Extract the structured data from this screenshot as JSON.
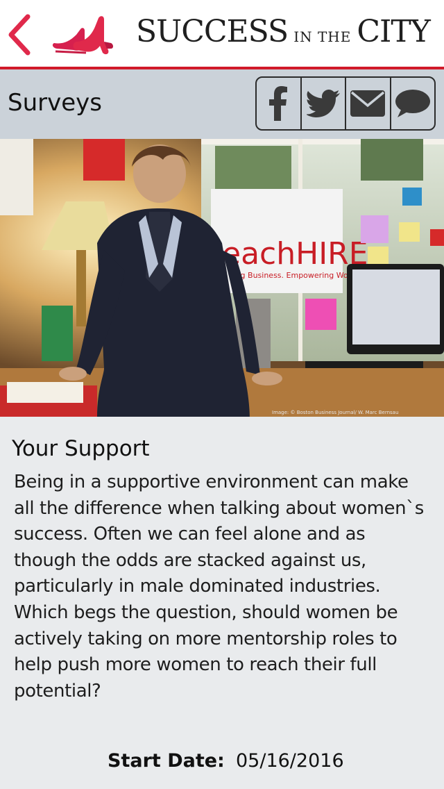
{
  "header": {
    "brand_big_1": "SUCCESS",
    "brand_small": "IN THE",
    "brand_big_2": "CITY",
    "back_icon": "chevron-left-icon",
    "logo_icon": "high-heel-shoes-logo",
    "accent_color": "#d11a2a"
  },
  "toolbar": {
    "title": "Surveys",
    "share_buttons": [
      {
        "icon": "facebook-icon"
      },
      {
        "icon": "twitter-icon"
      },
      {
        "icon": "email-icon"
      },
      {
        "icon": "comment-icon"
      }
    ]
  },
  "hero": {
    "sign_text_1": "eachHIRE",
    "sign_text_2": "ring Business. Empowering Women.",
    "credit": "Image: © Boston Business Journal/ W. Marc Bernsau"
  },
  "article": {
    "heading": "Your Support",
    "body": "Being in a supportive environment can make all the difference when talking about women`s success. Often we can feel alone and as though the odds are stacked against us, particularly in male dominated industries. Which begs the question, should women be actively taking on more mentorship roles to help push more women to reach their full potential?"
  },
  "survey": {
    "start_label": "Start Date:",
    "start_value": "05/16/2016"
  }
}
